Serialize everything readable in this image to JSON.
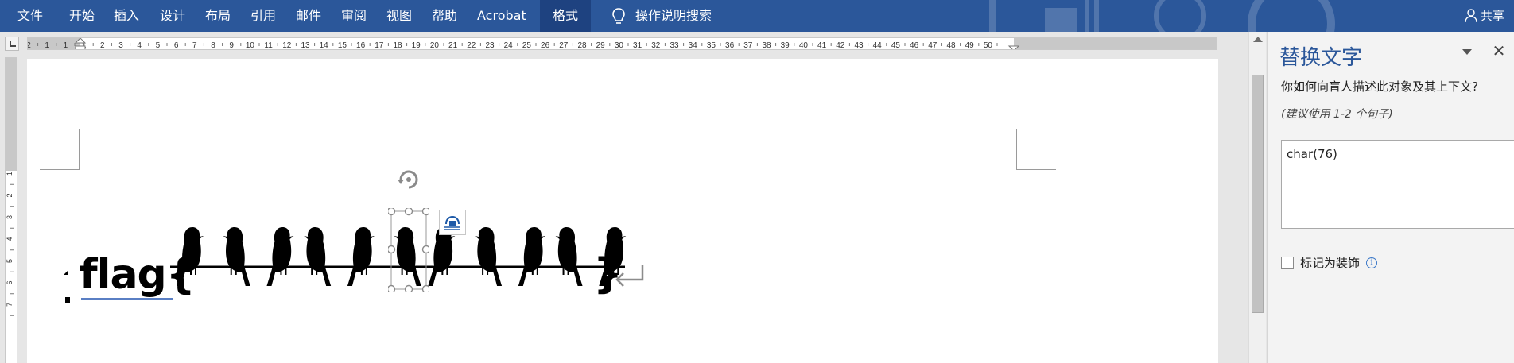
{
  "ribbon": {
    "tabs": [
      "文件",
      "开始",
      "插入",
      "设计",
      "布局",
      "引用",
      "邮件",
      "审阅",
      "视图",
      "帮助",
      "Acrobat",
      "格式"
    ],
    "active_tab": "格式",
    "search_label": "操作说明搜索",
    "share_label": "共享",
    "background_color": "#2b579a"
  },
  "ruler": {
    "horizontal_ticks": [
      "2",
      "1",
      "1",
      "1",
      "2",
      "3",
      "4",
      "5",
      "6",
      "7",
      "8",
      "9",
      "10",
      "11",
      "12",
      "13",
      "14",
      "15",
      "16",
      "17",
      "18",
      "19",
      "20",
      "21",
      "22",
      "23",
      "24",
      "25",
      "26",
      "27",
      "28",
      "29",
      "30",
      "31",
      "32",
      "33",
      "34",
      "35",
      "36",
      "37",
      "38",
      "39",
      "40",
      "41",
      "42",
      "43",
      "44",
      "45",
      "46",
      "47",
      "48",
      "49",
      "50"
    ],
    "vertical_ticks": [
      "4",
      "3",
      "2",
      "1",
      "1",
      "1",
      "2",
      "3",
      "4",
      "5",
      "6",
      "7"
    ]
  },
  "document": {
    "flag_prefix": "flag{",
    "flag_suffix": "}",
    "bird_count": 11,
    "bird_image_icon": "birds-on-wire-image"
  },
  "pane": {
    "title": "替换文字",
    "question": "你如何向盲人描述此对象及其上下文?",
    "hint": "(建议使用 1-2 个句子)",
    "alt_text_value": "char(76)",
    "decorative_label": "标记为装饰",
    "decorative_checked": false,
    "accent_color": "#2b579a"
  }
}
